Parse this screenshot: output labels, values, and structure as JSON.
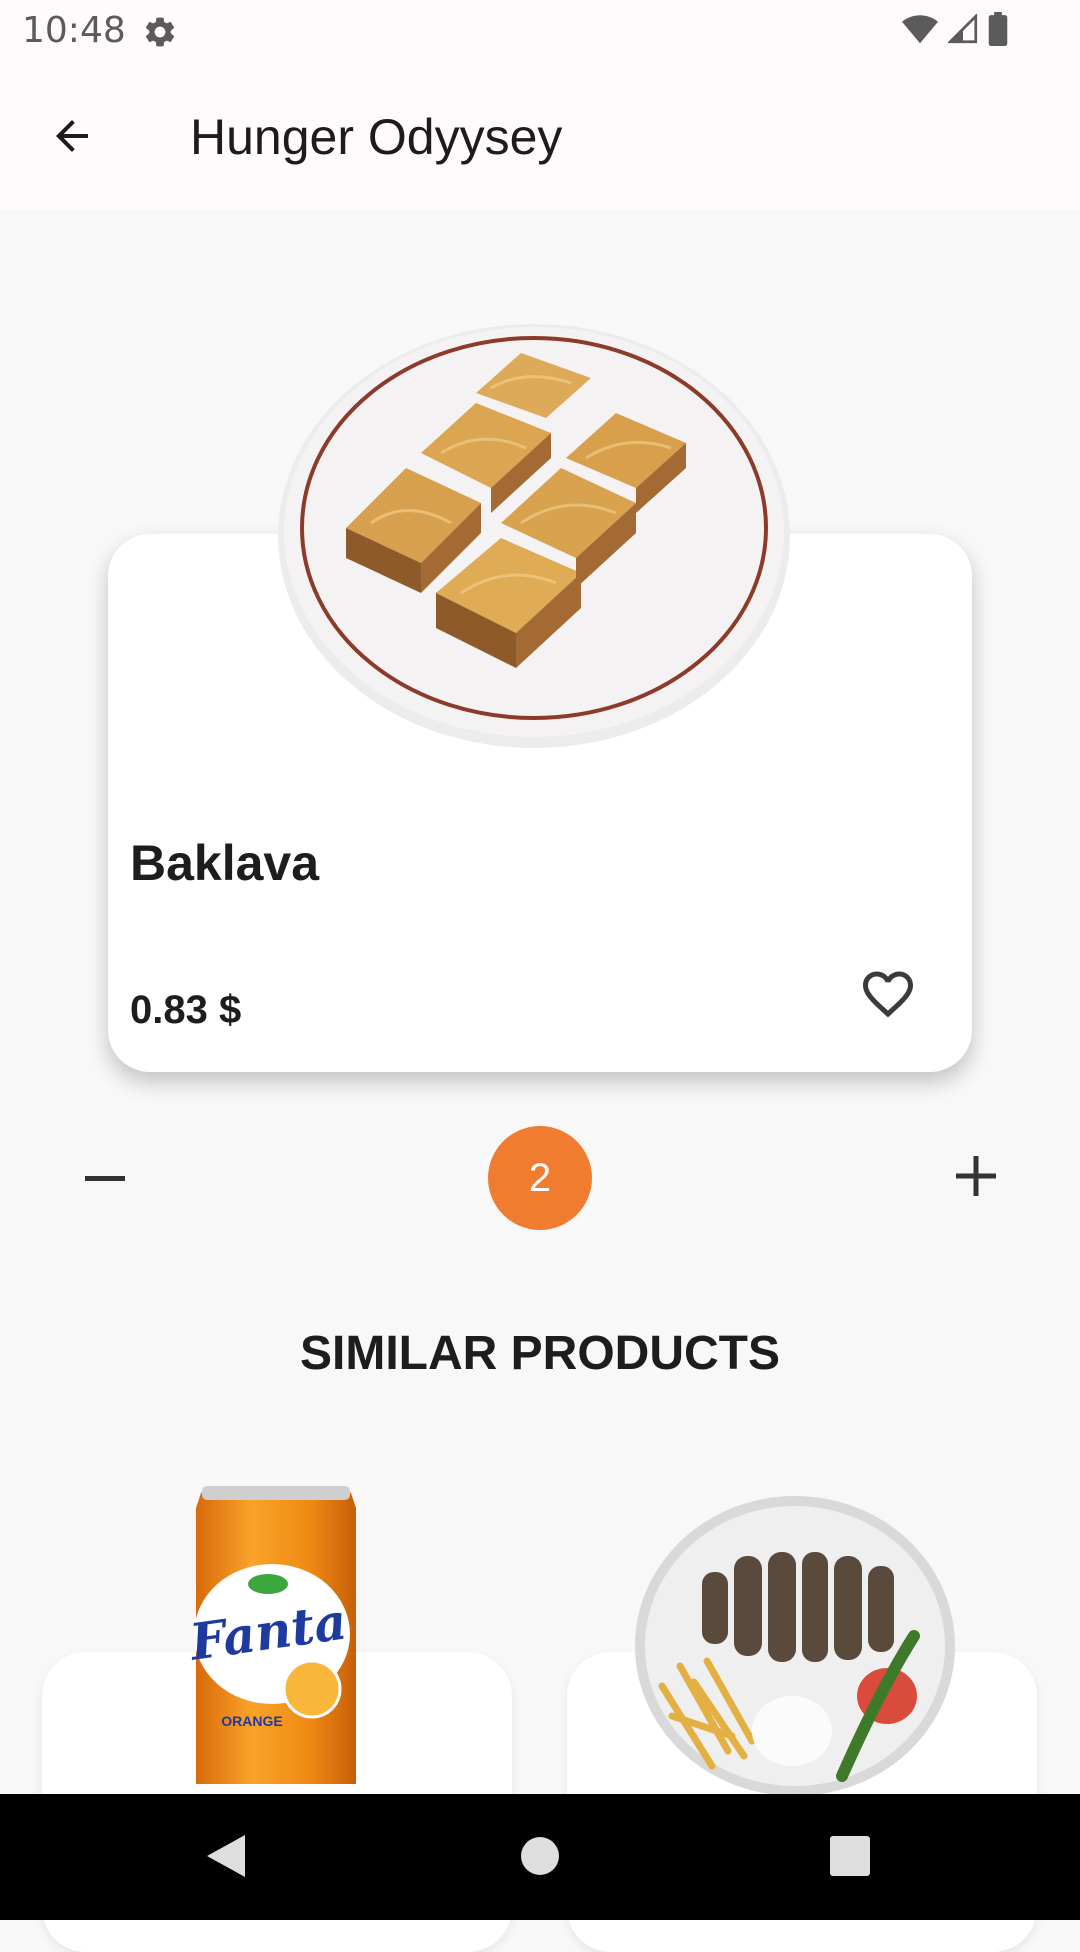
{
  "status_bar": {
    "time": "10:48",
    "settings_icon": "gear-icon",
    "wifi_icon": "wifi-icon",
    "signal_icon": "cell-signal-icon",
    "battery_icon": "battery-icon"
  },
  "app_bar": {
    "title": "Hunger Odyysey",
    "back_icon": "arrow-left-icon"
  },
  "product": {
    "name": "Baklava",
    "price": "0.83 $",
    "image": "baklava-plate",
    "favorite_icon": "heart-outline-icon"
  },
  "quantity": {
    "value": "2",
    "minus_icon": "minus-icon",
    "plus_icon": "plus-icon"
  },
  "similar": {
    "title": "SIMILAR PRODUCTS",
    "items": [
      {
        "image": "orange-soda-can",
        "can_brand": "Fanta",
        "can_flavor": "ORANGE"
      },
      {
        "image": "kebab-plate"
      }
    ]
  },
  "nav_bar": {
    "back_icon": "nav-back-icon",
    "home_icon": "nav-home-icon",
    "recents_icon": "nav-recents-icon"
  },
  "colors": {
    "accent": "#f07d2f",
    "app_bar_bg": "#fffbfd",
    "page_bg": "#f8f8f8",
    "card_bg": "#ffffff",
    "text": "#1d1d1d"
  }
}
